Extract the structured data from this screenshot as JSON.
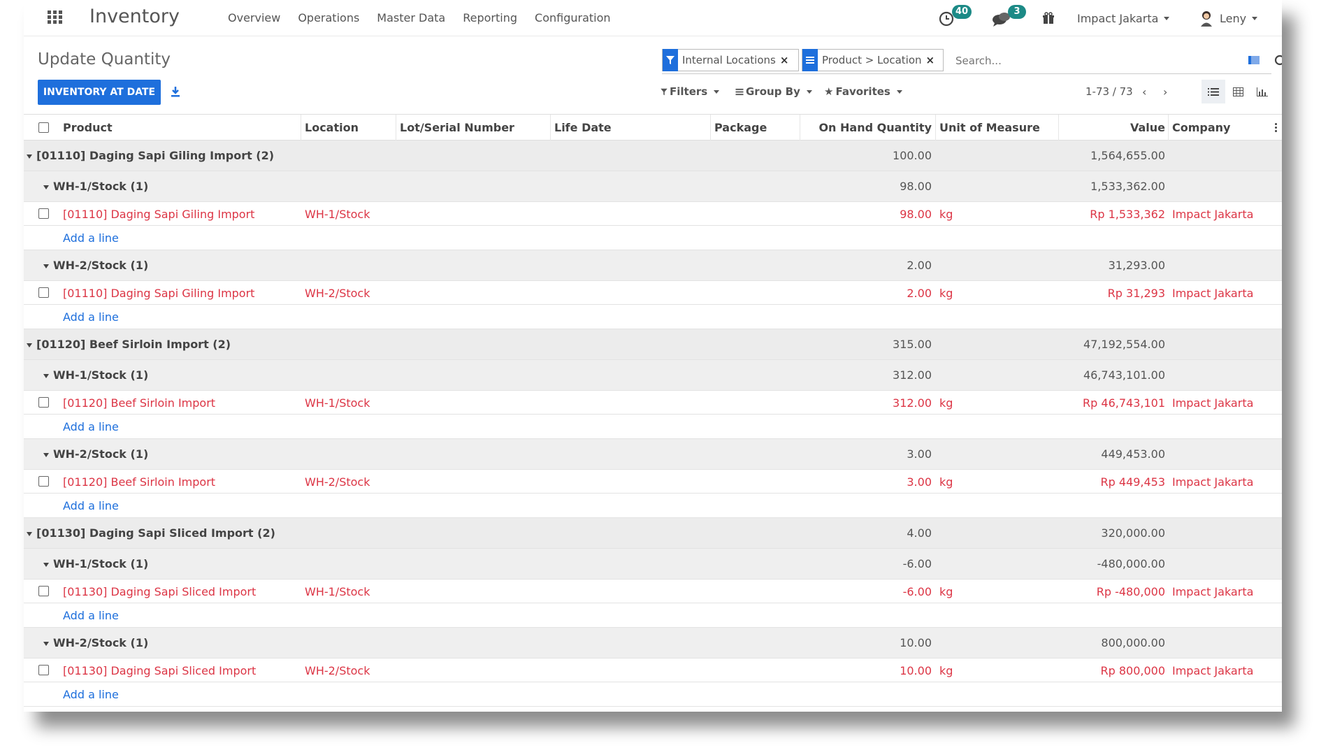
{
  "navbar": {
    "app_title": "Inventory",
    "menu": [
      "Overview",
      "Operations",
      "Master Data",
      "Reporting",
      "Configuration"
    ],
    "activity_count": "40",
    "message_count": "3",
    "company": "Impact Jakarta",
    "user": "Leny"
  },
  "control": {
    "breadcrumb": "Update Quantity",
    "inventory_at_date": "INVENTORY AT DATE",
    "facets": [
      "Internal Locations",
      "Product > Location"
    ],
    "search_placeholder": "Search...",
    "filters": "Filters",
    "group_by": "Group By",
    "favorites": "Favorites",
    "pager": "1-73 / 73"
  },
  "columns": [
    "Product",
    "Location",
    "Lot/Serial Number",
    "Life Date",
    "Package",
    "On Hand Quantity",
    "Unit of Measure",
    "Value",
    "Company"
  ],
  "groups": [
    {
      "label": "[01110] Daging Sapi Giling Import (2)",
      "qty": "100.00",
      "value": "1,564,655.00",
      "subgroups": [
        {
          "label": "WH-1/Stock (1)",
          "qty": "98.00",
          "value": "1,533,362.00",
          "record": {
            "product": "[01110] Daging Sapi Giling Import",
            "location": "WH-1/Stock",
            "qty": "98.00",
            "uom": "kg",
            "value": "Rp 1,533,362",
            "company": "Impact Jakarta"
          },
          "add_line": "Add a line"
        },
        {
          "label": "WH-2/Stock (1)",
          "qty": "2.00",
          "value": "31,293.00",
          "record": {
            "product": "[01110] Daging Sapi Giling Import",
            "location": "WH-2/Stock",
            "qty": "2.00",
            "uom": "kg",
            "value": "Rp 31,293",
            "company": "Impact Jakarta"
          },
          "add_line": "Add a line"
        }
      ]
    },
    {
      "label": "[01120] Beef Sirloin Import (2)",
      "qty": "315.00",
      "value": "47,192,554.00",
      "subgroups": [
        {
          "label": "WH-1/Stock (1)",
          "qty": "312.00",
          "value": "46,743,101.00",
          "record": {
            "product": "[01120] Beef Sirloin Import",
            "location": "WH-1/Stock",
            "qty": "312.00",
            "uom": "kg",
            "value": "Rp 46,743,101",
            "company": "Impact Jakarta"
          },
          "add_line": "Add a line"
        },
        {
          "label": "WH-2/Stock (1)",
          "qty": "3.00",
          "value": "449,453.00",
          "record": {
            "product": "[01120] Beef Sirloin Import",
            "location": "WH-2/Stock",
            "qty": "3.00",
            "uom": "kg",
            "value": "Rp 449,453",
            "company": "Impact Jakarta"
          },
          "add_line": "Add a line"
        }
      ]
    },
    {
      "label": "[01130] Daging Sapi Sliced Import (2)",
      "qty": "4.00",
      "value": "320,000.00",
      "subgroups": [
        {
          "label": "WH-1/Stock (1)",
          "qty": "-6.00",
          "value": "-480,000.00",
          "record": {
            "product": "[01130] Daging Sapi Sliced Import",
            "location": "WH-1/Stock",
            "qty": "-6.00",
            "uom": "kg",
            "value": "Rp -480,000",
            "company": "Impact Jakarta"
          },
          "add_line": "Add a line"
        },
        {
          "label": "WH-2/Stock (1)",
          "qty": "10.00",
          "value": "800,000.00",
          "record": {
            "product": "[01130] Daging Sapi Sliced Import",
            "location": "WH-2/Stock",
            "qty": "10.00",
            "uom": "kg",
            "value": "Rp 800,000",
            "company": "Impact Jakarta"
          },
          "add_line": "Add a line"
        }
      ]
    }
  ],
  "colors": {
    "primary": "#1e6fdc",
    "record_text": "#dc3545",
    "badge": "#1c8a86"
  }
}
